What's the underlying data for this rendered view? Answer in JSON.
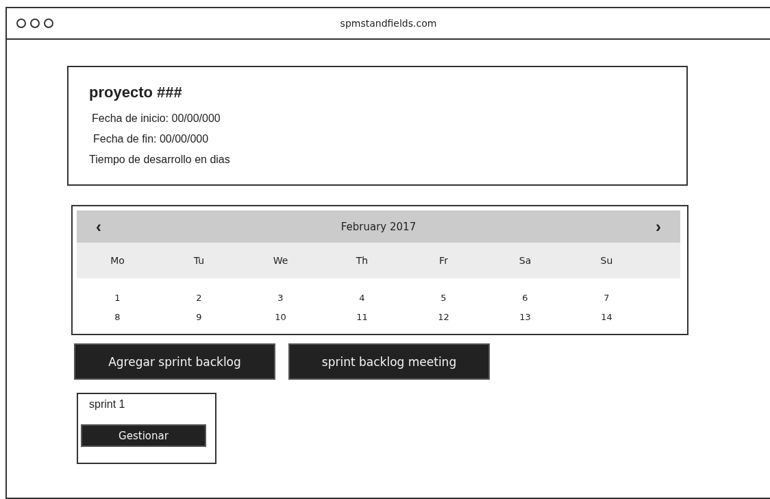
{
  "window": {
    "title": "spmstandfields.com"
  },
  "project": {
    "title": "proyecto ###",
    "lines": [
      "Fecha de inicio: 00/00/000",
      "Fecha de fin: 00/00/000",
      "Tiempo de desarrollo en dias"
    ]
  },
  "calendar": {
    "prev": "‹",
    "month": "February 2017",
    "next": "›",
    "weekdays": [
      "Mo",
      "Tu",
      "We",
      "Th",
      "Fr",
      "Sa",
      "Su"
    ],
    "weeks": [
      [
        "1",
        "2",
        "3",
        "4",
        "5",
        "6",
        "7"
      ],
      [
        "8",
        "9",
        "10",
        "11",
        "12",
        "13",
        "14"
      ]
    ]
  },
  "actions": [
    "Agregar sprint backlog",
    "sprint backlog meeting"
  ],
  "sprints": [
    {
      "name": "sprint 1",
      "button": "Gestionar"
    }
  ]
}
